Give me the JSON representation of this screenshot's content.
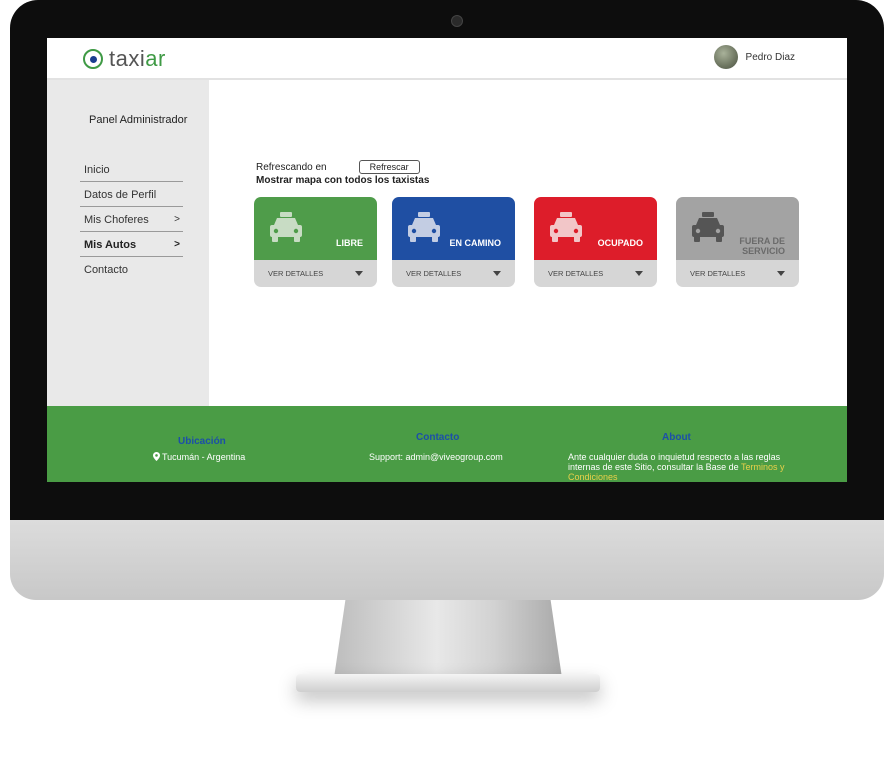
{
  "header": {
    "logo_text_a": "taxi",
    "logo_text_b": "ar",
    "user_name": "Pedro Diaz"
  },
  "sidebar": {
    "title": "Panel Administrador",
    "items": [
      {
        "label": "Inicio",
        "chevron": ""
      },
      {
        "label": "Datos de Perfil",
        "chevron": ""
      },
      {
        "label": "Mis Choferes",
        "chevron": ">"
      },
      {
        "label": "Mis Autos",
        "chevron": ">"
      },
      {
        "label": "Contacto",
        "chevron": ""
      }
    ]
  },
  "main": {
    "refresh_text": "Refrescando en",
    "refresh_button": "Refrescar",
    "map_link": "Mostrar mapa con todos los taxistas",
    "cards": [
      {
        "status": "LIBRE",
        "details": "VER DETALLES",
        "color": "#4f9c4a",
        "icon": "taxi-icon"
      },
      {
        "status": "EN CAMINO",
        "details": "VER DETALLES",
        "color": "#1f4fa3",
        "icon": "taxi-icon"
      },
      {
        "status": "OCUPADO",
        "details": "VER DETALLES",
        "color": "#dd1d2a",
        "icon": "taxi-icon"
      },
      {
        "status_line1": "FUERA DE",
        "status_line2": "SERVICIO",
        "details": "VER DETALLES",
        "color": "#a3a3a3",
        "icon": "taxi-icon"
      }
    ]
  },
  "footer": {
    "ubicacion_title": "Ubicación",
    "ubicacion_text": "Tucumán - Argentina",
    "contacto_title": "Contacto",
    "contacto_text": "Support: admin@viveogroup.com",
    "about_title": "About",
    "about_text_1": "Ante cualquier duda o inquietud respecto a las reglas",
    "about_text_2": "internas de este Sitio, consultar la Base de ",
    "about_terms_a": "Terminos y",
    "about_terms_b": "Condiciones"
  },
  "colors": {
    "accent_green": "#3f9a45",
    "footer_green": "#4a9c45",
    "footer_title_blue": "#1c4fa8",
    "terms_yellow": "#e9d04a"
  }
}
